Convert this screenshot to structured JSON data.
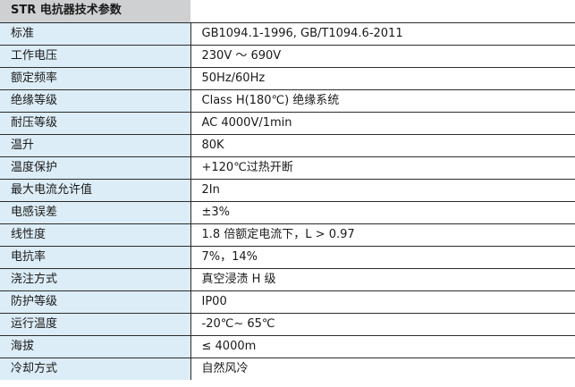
{
  "table": {
    "title": "STR 电抗器技术参数",
    "rows": [
      {
        "name": "标准",
        "value": "GB1094.1-1996, GB/T1094.6-2011"
      },
      {
        "name": "工作电压",
        "value": "230V ～ 690V"
      },
      {
        "name": "额定频率",
        "value": "50Hz/60Hz"
      },
      {
        "name": "绝缘等级",
        "value": "Class H(180℃) 绝缘系统"
      },
      {
        "name": "耐压等级",
        "value": "AC 4000V/1min"
      },
      {
        "name": "温升",
        "value": "80K"
      },
      {
        "name": "温度保护",
        "value": "+120℃过热开断"
      },
      {
        "name": "最大电流允许值",
        "value": "2In"
      },
      {
        "name": "电感误差",
        "value": "±3%"
      },
      {
        "name": "线性度",
        "value": "1.8 倍额定电流下，L > 0.97"
      },
      {
        "name": "电抗率",
        "value": "7%，14%"
      },
      {
        "name": "浇注方式",
        "value": "真空浸渍 H 级"
      },
      {
        "name": "防护等级",
        "value": "IP00"
      },
      {
        "name": "运行温度",
        "value": "-20℃~ 65℃"
      },
      {
        "name": "海拔",
        "value": "≤ 4000m"
      },
      {
        "name": "冷却方式",
        "value": "自然风冷"
      }
    ]
  }
}
